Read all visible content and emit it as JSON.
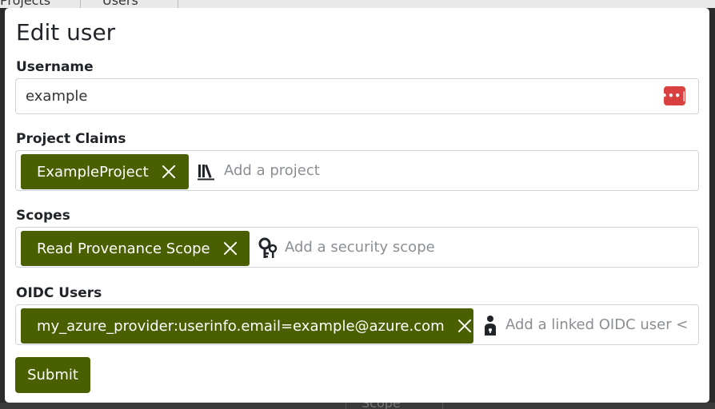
{
  "background": {
    "tabs": [
      "Projects",
      "Users"
    ],
    "table_header": "Scope"
  },
  "modal": {
    "title": "Edit user",
    "username": {
      "label": "Username",
      "value": "example",
      "password_manager_icon": "password-manager-icon"
    },
    "project_claims": {
      "label": "Project Claims",
      "chips": [
        {
          "label": "ExampleProject"
        }
      ],
      "icon": "library-books-icon",
      "placeholder": "Add a project"
    },
    "scopes": {
      "label": "Scopes",
      "chips": [
        {
          "label": "Read Provenance Scope"
        }
      ],
      "icon": "key-icon",
      "placeholder": "Add a security scope"
    },
    "oidc_users": {
      "label": "OIDC Users",
      "chips": [
        {
          "label": "my_azure_provider:userinfo.email=example@azure.com"
        }
      ],
      "icon": "user-lock-icon",
      "placeholder": "Add a linked OIDC user <"
    },
    "submit_label": "Submit"
  },
  "colors": {
    "accent": "#4a5f00",
    "password_icon": "#d94141",
    "border": "#d0d4d8"
  }
}
